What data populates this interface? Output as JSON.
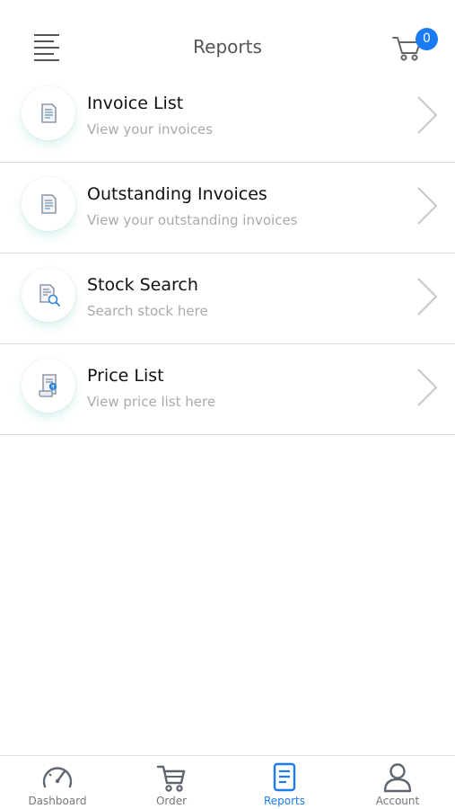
{
  "header": {
    "title": "Reports",
    "cart_count": "0"
  },
  "reports": [
    {
      "title": "Invoice List",
      "subtitle": "View your invoices",
      "icon": "invoice-icon"
    },
    {
      "title": "Outstanding Invoices",
      "subtitle": "View your outstanding invoices",
      "icon": "invoice-icon"
    },
    {
      "title": "Stock Search",
      "subtitle": "Search stock here",
      "icon": "stock-search-icon"
    },
    {
      "title": "Price List",
      "subtitle": "View price list here",
      "icon": "price-list-icon"
    }
  ],
  "tabs": [
    {
      "label": "Dashboard",
      "icon": "speedometer-icon"
    },
    {
      "label": "Order",
      "icon": "cart-icon"
    },
    {
      "label": "Reports",
      "icon": "document-icon",
      "active": true
    },
    {
      "label": "Account",
      "icon": "user-icon"
    }
  ],
  "colors": {
    "accent": "#1a7bf2",
    "divider": "#dcdcdc",
    "subtitle": "#aaaaaa"
  }
}
